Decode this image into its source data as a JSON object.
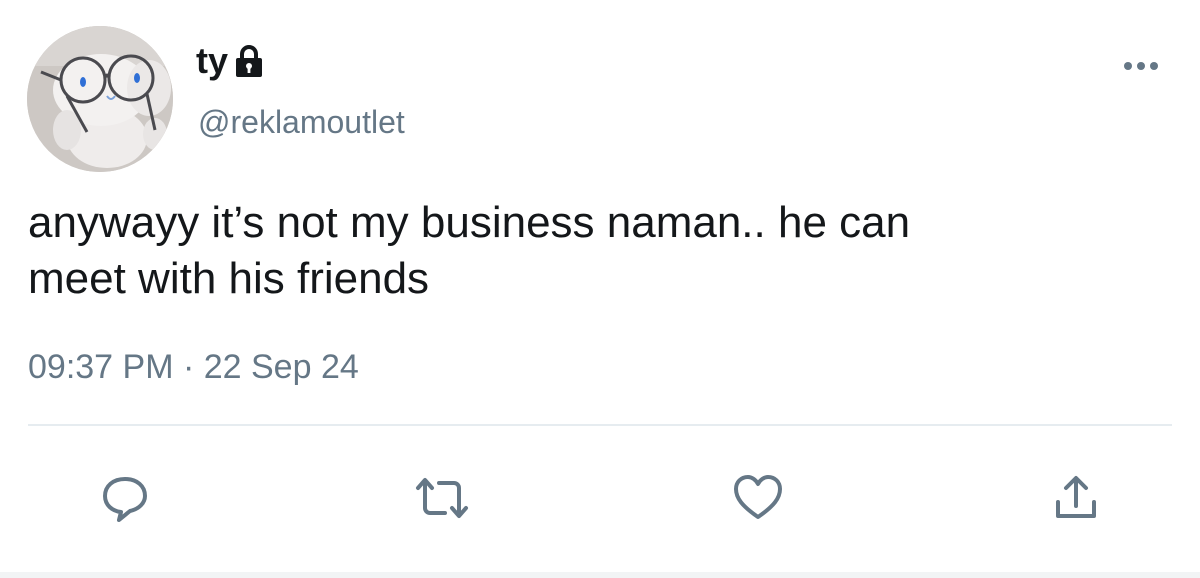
{
  "user": {
    "display_name": "ty",
    "handle": "@reklamoutlet",
    "protected_icon": "lock-icon",
    "avatar_icon": "avatar-plush-with-glasses"
  },
  "tweet": {
    "text": "anywayy it’s not my business naman.. he can\nmeet with his friends",
    "timestamp": "09:37 PM · 22 Sep 24"
  },
  "actions": [
    {
      "name": "reply",
      "icon": "comment-icon"
    },
    {
      "name": "retweet",
      "icon": "retweet-icon"
    },
    {
      "name": "like",
      "icon": "heart-icon"
    },
    {
      "name": "share",
      "icon": "share-icon"
    }
  ],
  "colors": {
    "text": "#14171a",
    "secondary": "#657786",
    "divider": "#e6ecf0",
    "icon": "#657786"
  }
}
